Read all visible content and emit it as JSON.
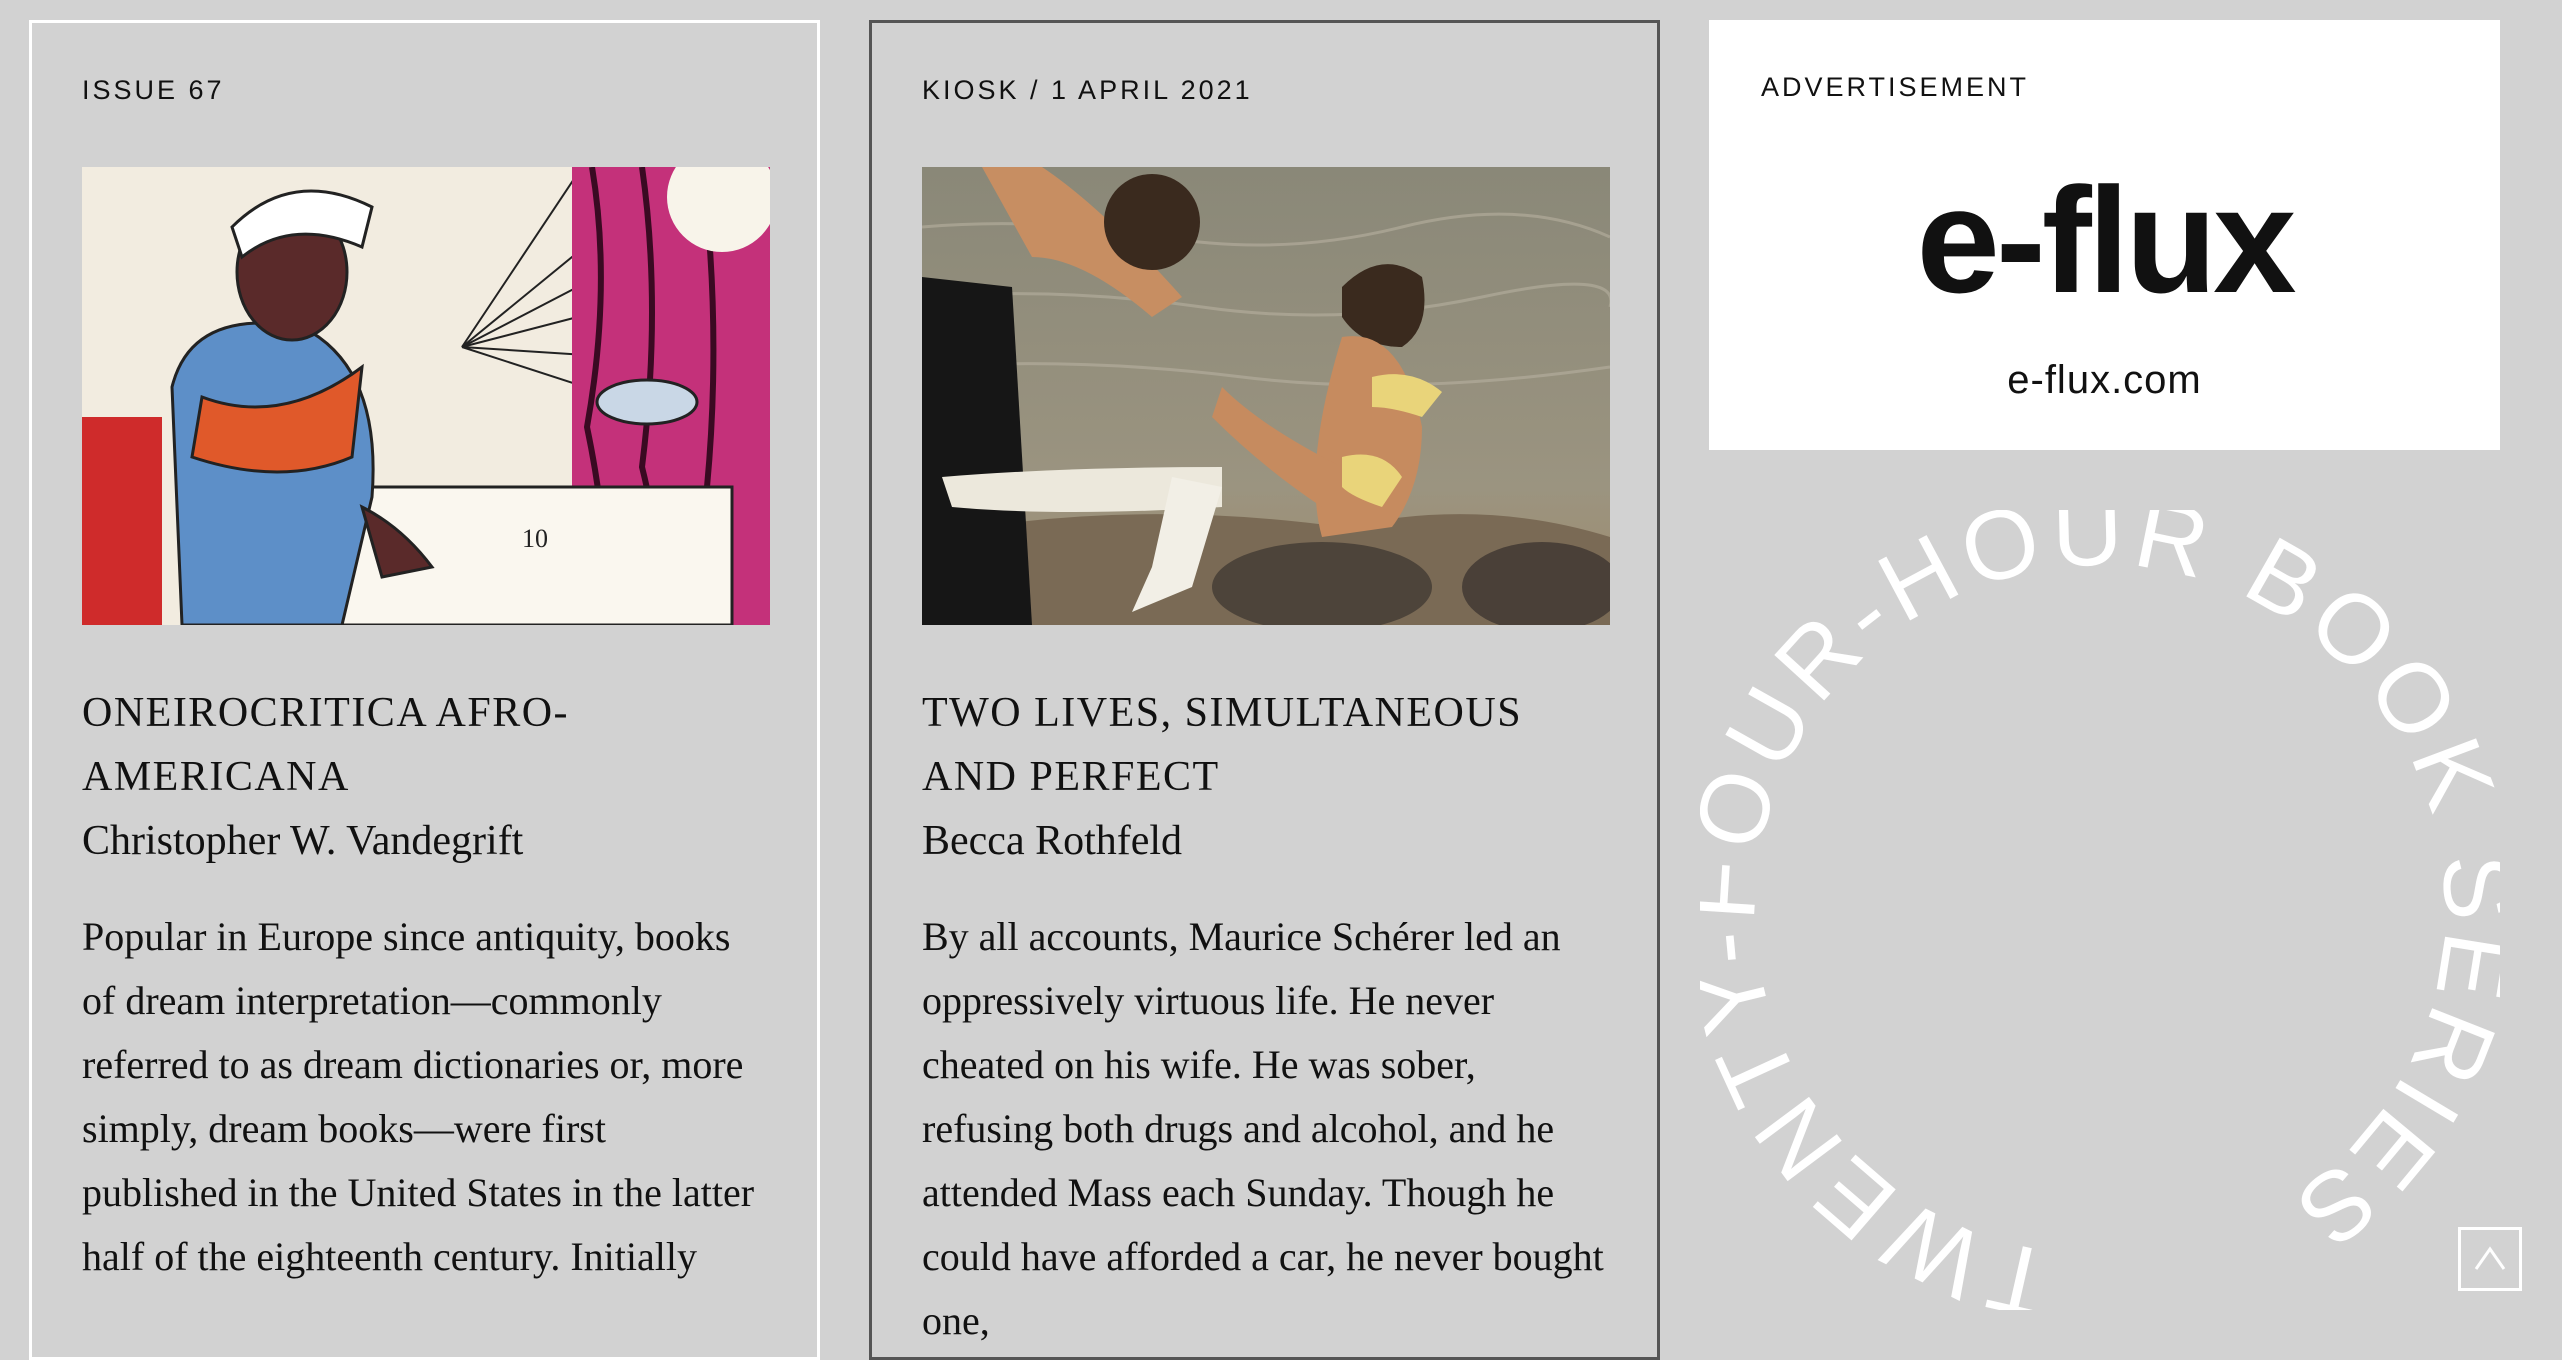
{
  "cards": [
    {
      "kicker": "ISSUE 67",
      "title": "ONEIROCRITICA AFRO-AMERICANA",
      "author": "Christopher W. Vandegrift",
      "excerpt": "Popular in Europe since antiquity, books of dream interpretation—commonly referred to as dream dictionaries or, more simply, dream books—were first published in the United States in the latter half of the eighteenth century. Initially"
    },
    {
      "kicker": "KIOSK / 1 APRIL 2021",
      "title": "TWO LIVES, SIMULTANEOUS AND PERFECT",
      "author": "Becca Rothfeld",
      "excerpt": "By all accounts, Maurice Schérer led an oppressively virtuous life. He never cheated on his wife. He was sober, refusing both drugs and alcohol, and he attended Mass each Sunday. Though he could have afforded a car, he never bought one,"
    }
  ],
  "ad": {
    "kicker": "ADVERTISEMENT",
    "logo": "e-flux",
    "url": "e-flux.com"
  },
  "promo": {
    "circular_text": "TWENTY-FOUR-HOUR BOOK SERIES "
  },
  "controls": {
    "scroll_top_icon": "caret-up-icon"
  },
  "colors": {
    "background": "#d2d2d2",
    "card1_border": "#ffffff",
    "card2_border": "#555555",
    "ring_text": "#ffffff"
  }
}
